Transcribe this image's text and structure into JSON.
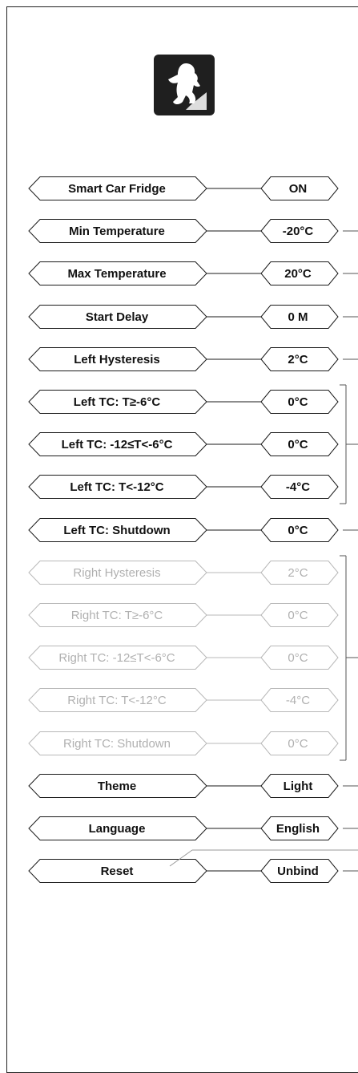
{
  "logo": {
    "icon": "bigfoot-logo-icon",
    "background": "#1f1f1f"
  },
  "rows": [
    {
      "label": "Smart Car Fridge",
      "value": "ON",
      "enabled": true
    },
    {
      "label": "Min Temperature",
      "value": "-20°C",
      "enabled": true
    },
    {
      "label": "Max Temperature",
      "value": "20°C",
      "enabled": true
    },
    {
      "label": "Start Delay",
      "value": "0 M",
      "enabled": true
    },
    {
      "label": "Left Hysteresis",
      "value": "2°C",
      "enabled": true
    },
    {
      "label": "Left TC: T≥-6°C",
      "value": "0°C",
      "enabled": true
    },
    {
      "label": "Left TC: -12≤T<-6°C",
      "value": "0°C",
      "enabled": true
    },
    {
      "label": "Left TC: T<-12°C",
      "value": "-4°C",
      "enabled": true
    },
    {
      "label": "Left TC: Shutdown",
      "value": "0°C",
      "enabled": true
    },
    {
      "label": "Right Hysteresis",
      "value": "2°C",
      "enabled": false
    },
    {
      "label": "Right TC: T≥-6°C",
      "value": "0°C",
      "enabled": false
    },
    {
      "label": "Right TC: -12≤T<-6°C",
      "value": "0°C",
      "enabled": false
    },
    {
      "label": "Right TC: T<-12°C",
      "value": "-4°C",
      "enabled": false
    },
    {
      "label": "Right TC: Shutdown",
      "value": "0°C",
      "enabled": false
    },
    {
      "label": "Theme",
      "value": "Light",
      "enabled": true
    },
    {
      "label": "Language",
      "value": "English",
      "enabled": true
    },
    {
      "label": "Reset",
      "value": "Unbind",
      "enabled": true
    }
  ],
  "colors": {
    "enabled": "#111111",
    "disabled": "#b0b0b0"
  }
}
